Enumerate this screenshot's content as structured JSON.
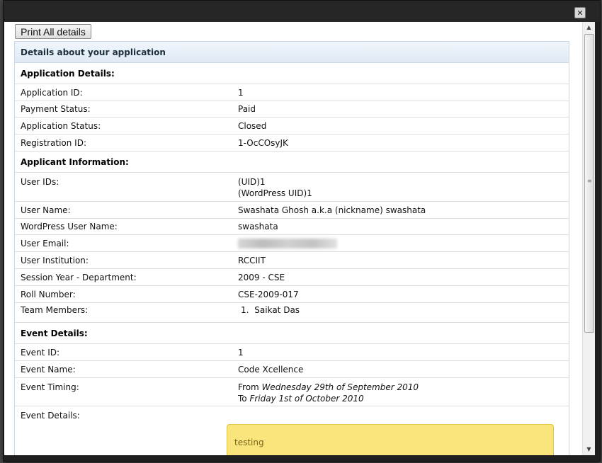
{
  "toolbar": {
    "print_label": "Print All details"
  },
  "panel_title": "Details about your application",
  "sections": {
    "application": "Application Details:",
    "applicant": "Applicant Information:",
    "event": "Event Details:"
  },
  "application": {
    "id_label": "Application ID:",
    "id_value": "1",
    "payment_label": "Payment Status:",
    "payment_value": "Paid",
    "status_label": "Application Status:",
    "status_value": "Closed",
    "reg_label": "Registration ID:",
    "reg_value": "1-OcCOsyJK"
  },
  "applicant": {
    "uids_label": "User IDs:",
    "uid_line1": "(UID)1",
    "uid_line2": "(WordPress UID)1",
    "name_label": "User Name:",
    "name_value": "Swashata Ghosh a.k.a (nickname) swashata",
    "wp_label": "WordPress User Name:",
    "wp_value": "swashata",
    "email_label": "User Email:",
    "inst_label": "User Institution:",
    "inst_value": "RCCIIT",
    "session_label": "Session Year - Department:",
    "session_value": "2009 - CSE",
    "roll_label": "Roll Number:",
    "roll_value": "CSE-2009-017",
    "team_label": "Team Members:",
    "team_num": "1.",
    "team_member": "Saikat Das"
  },
  "event": {
    "id_label": "Event ID:",
    "id_value": "1",
    "name_label": "Event Name:",
    "name_value": "Code Xcellence",
    "timing_label": "Event Timing:",
    "from_word": "From",
    "from_date": "Wednesday 29th of September 2010",
    "to_word": "To",
    "to_date": "Friday 1st of October 2010",
    "details_label": "Event Details:",
    "details_text": "testing"
  }
}
